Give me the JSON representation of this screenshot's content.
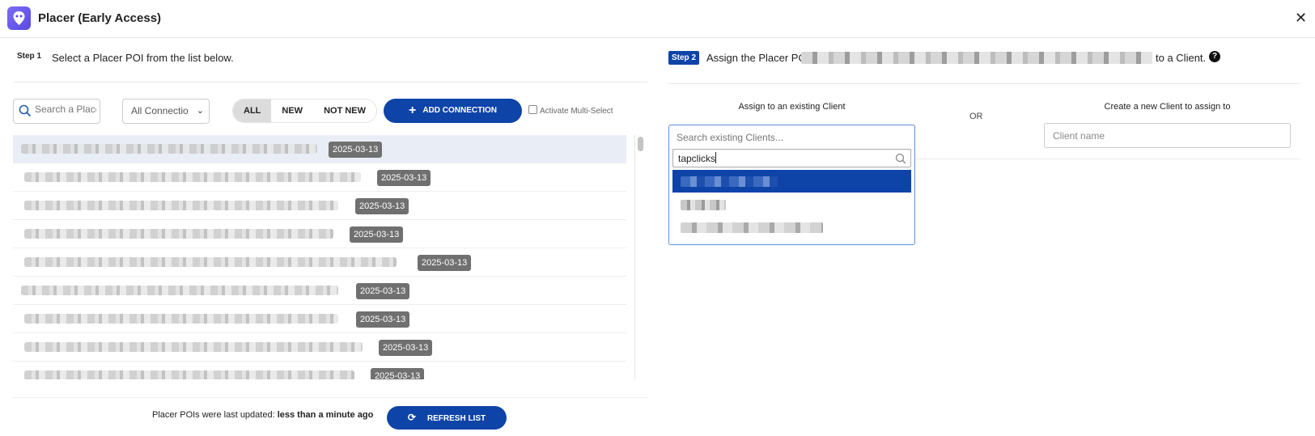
{
  "app": {
    "title": "Placer (Early Access)",
    "close_glyph": "✕"
  },
  "step1": {
    "tag": "Step 1",
    "text": "Select a Placer POI from the list below.",
    "search_placeholder": "Search a Placer POI",
    "connection_select": "All Connectio",
    "filters": [
      "ALL",
      "NEW",
      "NOT NEW"
    ],
    "active_filter": "ALL",
    "add_connection_label": "ADD CONNECTION",
    "multi_select_label": "Activate Multi-Select",
    "multi_select_checked": false
  },
  "poi_list": {
    "rows": [
      {
        "date": "2025-03-13",
        "selected": true
      },
      {
        "date": "2025-03-13",
        "selected": false
      },
      {
        "date": "2025-03-13",
        "selected": false
      },
      {
        "date": "2025-03-13",
        "selected": false
      },
      {
        "date": "2025-03-13",
        "selected": false
      },
      {
        "date": "2025-03-13",
        "selected": false
      },
      {
        "date": "2025-03-13",
        "selected": false
      },
      {
        "date": "2025-03-13",
        "selected": false
      },
      {
        "date": "2025-03-13",
        "selected": false
      }
    ]
  },
  "footer": {
    "updated_prefix": "Placer POIs were last updated:",
    "updated_value": "less than a minute ago",
    "refresh_label": "REFRESH LIST"
  },
  "step2": {
    "tag": "Step 2",
    "text_before": "Assign the Placer POI",
    "text_after": "to a Client.",
    "help": "?",
    "assign_existing_label": "Assign to an existing Client",
    "or_label": "OR",
    "create_new_label": "Create a new Client to assign to",
    "client_name_placeholder": "Client name",
    "existing_placeholder": "Search existing Clients...",
    "dropdown_search_value": "tapclicks",
    "highlighted_option_index": 0
  },
  "colors": {
    "primary": "#0e44a8",
    "date_badge": "#707070",
    "selected_row": "#e9eef6"
  },
  "icons": {
    "search": "search-icon",
    "add": "plus-icon",
    "refresh": "refresh-icon",
    "help": "help-icon",
    "close": "close-icon",
    "logo": "placer-logo-icon"
  }
}
